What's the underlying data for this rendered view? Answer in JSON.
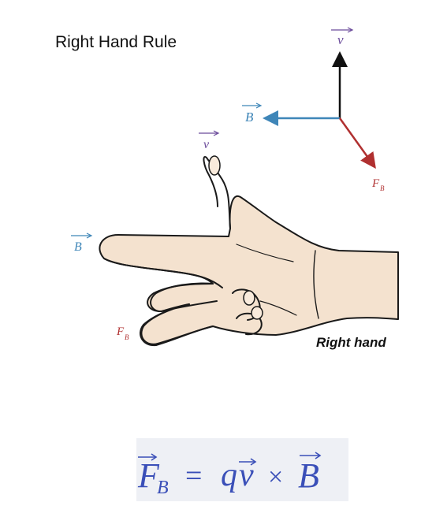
{
  "title": "Right Hand Rule",
  "axes_labels": {
    "v": "v",
    "B": "B",
    "F": "F",
    "F_sub": "B"
  },
  "hand_labels": {
    "v": "v",
    "B": "B",
    "F": "F",
    "F_sub": "B"
  },
  "caption": "Right hand",
  "formula": {
    "lhs": "F",
    "lhs_sub": "B",
    "equals": "=",
    "q": "q",
    "v": "v",
    "times": "×",
    "B": "B"
  },
  "colors": {
    "v": "#6a4a9a",
    "B": "#3f86b8",
    "F": "#b03030",
    "formula": "#3a4fb8",
    "skin": "#f4e2cf"
  }
}
